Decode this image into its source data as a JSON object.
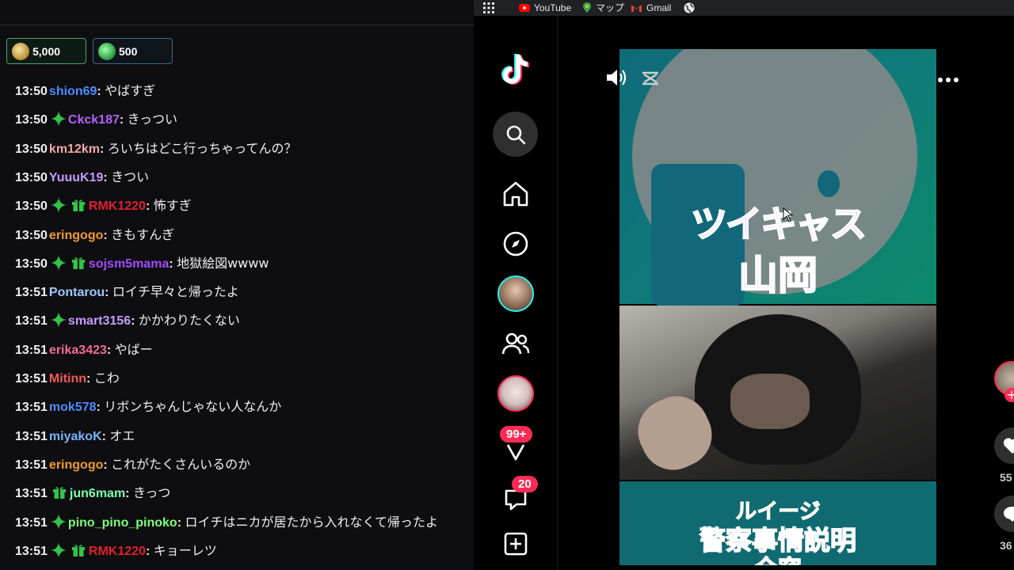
{
  "bookmarks": {
    "items": [
      {
        "label": "YouTube",
        "icon": "youtube-icon",
        "color": "#ff0000"
      },
      {
        "label": "マップ",
        "icon": "maps-icon",
        "color": "#34a853"
      },
      {
        "label": "Gmail",
        "icon": "gmail-icon",
        "color": "#ea4335"
      }
    ]
  },
  "points": {
    "channel_points": "5,000",
    "second_points": "500"
  },
  "colors": {
    "star": "#33c24a",
    "gift": "#33c24a",
    "tiktok_pink": "#fe2c55",
    "tiktok_cyan": "#25f4ee"
  },
  "chat": {
    "messages": [
      {
        "time": "13:50",
        "user": "shion69",
        "color": "#4d8bff",
        "star": false,
        "gift": false,
        "text": "やばすぎ"
      },
      {
        "time": "13:50",
        "user": "Ckck187",
        "color": "#b461ff",
        "star": true,
        "gift": false,
        "text": "きっつい"
      },
      {
        "time": "13:50",
        "user": "km12km",
        "color": "#f2a7a7",
        "star": false,
        "gift": false,
        "text": "ろいちはどこ行っちゃってんの？"
      },
      {
        "time": "13:50",
        "user": "YuuuK19",
        "color": "#c69aff",
        "star": false,
        "gift": false,
        "text": "きつい"
      },
      {
        "time": "13:50",
        "user": "RMK1220",
        "color": "#e0202f",
        "star": true,
        "gift": true,
        "text": "怖すぎ"
      },
      {
        "time": "13:50",
        "user": "eringogo",
        "color": "#f29a2e",
        "star": false,
        "gift": false,
        "text": "きもすんぎ"
      },
      {
        "time": "13:50",
        "user": "sojsm5mama",
        "color": "#a24bff",
        "star": true,
        "gift": true,
        "text": "地獄絵図wwww"
      },
      {
        "time": "13:51",
        "user": "Pontarou",
        "color": "#9ec9ff",
        "star": false,
        "gift": false,
        "text": "ロイチ早々と帰ったよ"
      },
      {
        "time": "13:51",
        "user": "smart3156",
        "color": "#c89bff",
        "star": true,
        "gift": false,
        "text": "かかわりたくない"
      },
      {
        "time": "13:51",
        "user": "erika3423",
        "color": "#f26a9a",
        "star": false,
        "gift": false,
        "text": "やばー"
      },
      {
        "time": "13:51",
        "user": "Mitinn",
        "color": "#f05a5a",
        "star": false,
        "gift": false,
        "text": "こわ"
      },
      {
        "time": "13:51",
        "user": "mok578",
        "color": "#4d8bff",
        "star": false,
        "gift": false,
        "text": "リボンちゃんじゃない人なんか"
      },
      {
        "time": "13:51",
        "user": "miyakoK",
        "color": "#7ab3ff",
        "star": false,
        "gift": false,
        "text": "オエ"
      },
      {
        "time": "13:51",
        "user": "eringogo",
        "color": "#f29a2e",
        "star": false,
        "gift": false,
        "text": "これがたくさんいるのか"
      },
      {
        "time": "13:51",
        "user": "jun6mam",
        "color": "#7cffb0",
        "star": false,
        "gift": true,
        "text": "きっつ"
      },
      {
        "time": "13:51",
        "user": "pino_pino_pinoko",
        "color": "#7cff7c",
        "star": true,
        "gift": false,
        "text": "ロイチはニカが居たから入れなくて帰ったよ"
      },
      {
        "time": "13:51",
        "user": "RMK1220",
        "color": "#e0202f",
        "star": true,
        "gift": true,
        "text": "キョーレツ"
      }
    ]
  },
  "tiktok": {
    "sidebar": {
      "icons": [
        "tiktok-logo-icon",
        "search-icon",
        "home-icon",
        "explore-icon",
        "live-avatar",
        "following-icon",
        "friend-avatar",
        "activity-icon",
        "messages-icon",
        "upload-icon"
      ],
      "activity_badge": "99+",
      "messages_badge": "20"
    },
    "video": {
      "title_top_1": "ツイキャス",
      "title_top_2": "山岡",
      "title_bottom_1": "ルイージ",
      "title_bottom_2": "警察事情説明",
      "title_bottom_3": "全容"
    },
    "actions": {
      "like_count": "55",
      "comment_count": "36"
    }
  }
}
